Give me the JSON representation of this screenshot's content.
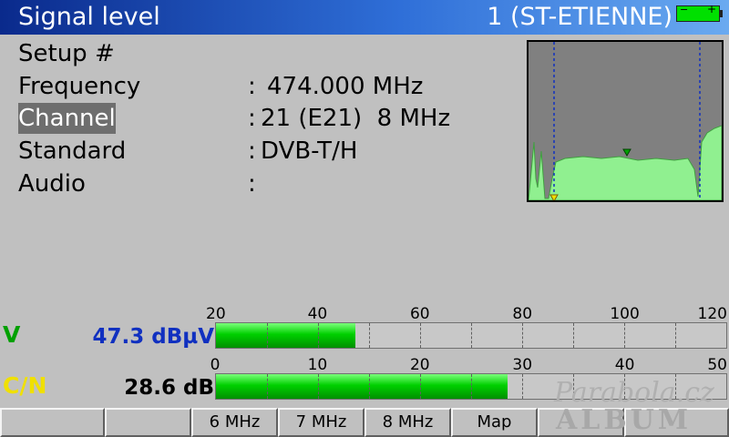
{
  "header": {
    "title": "Signal level",
    "location": "1 (ST-ETIENNE)",
    "battery_minus": "−",
    "battery_plus": "+"
  },
  "info": {
    "setup": {
      "label": "Setup #",
      "value": ""
    },
    "frequency": {
      "label": "Frequency",
      "colon": ":",
      "value": "474.000 MHz"
    },
    "channel": {
      "label": "Channel",
      "colon": ":",
      "value": "21 (E21)  8 MHz"
    },
    "standard": {
      "label": "Standard",
      "colon": ":",
      "value": "DVB-T/H"
    },
    "audio": {
      "label": "Audio",
      "colon": ":",
      "value": ""
    }
  },
  "meters": {
    "level": {
      "label": "V",
      "label_color": "#00a000",
      "value": "47.3 dBµV",
      "value_color": "#1030c0",
      "scale": [
        "20",
        "40",
        "60",
        "80",
        "100",
        "120"
      ],
      "min": 20,
      "max": 120,
      "reading": 47.3
    },
    "cn": {
      "label": "C/N",
      "label_color": "#f0e000",
      "value": "28.6 dB",
      "value_color": "#000000",
      "scale": [
        "0",
        "10",
        "20",
        "30",
        "40",
        "50"
      ],
      "min": 0,
      "max": 50,
      "reading": 28.6
    }
  },
  "softkeys": [
    "",
    "",
    "6 MHz",
    "7 MHz",
    "8 MHz",
    "Map",
    "",
    ""
  ],
  "watermark": {
    "line1": "Parabola.cz",
    "line2": "ALBUM"
  },
  "colors": {
    "spectrum_fill": "#90f090",
    "spectrum_bg": "#808080",
    "marker": "#00a000"
  }
}
